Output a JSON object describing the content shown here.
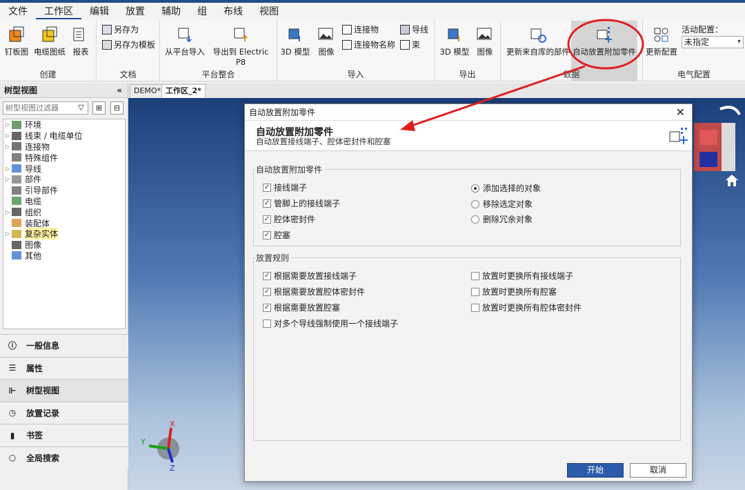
{
  "menu": [
    "文件",
    "工作区",
    "编辑",
    "放置",
    "辅助",
    "组",
    "布线",
    "视图"
  ],
  "menu_active": "工作区",
  "ribbon": {
    "create": {
      "label": "创建",
      "buttons": [
        "钉板图",
        "电缆图纸",
        "报表"
      ]
    },
    "doc": {
      "label": "文档",
      "buttons": [
        "另存为",
        "另存为模板"
      ]
    },
    "platform": {
      "label": "平台整合",
      "buttons": [
        "从平台导入",
        "导出到 Electric P8"
      ]
    },
    "import": {
      "label": "导入",
      "buttons": [
        "3D 模型",
        "图像",
        "连接物",
        "连接物名称",
        "导线",
        "束"
      ]
    },
    "export": {
      "label": "导出",
      "buttons": [
        "3D 模型",
        "图像"
      ]
    },
    "data": {
      "label": "数据",
      "buttons": [
        "更新来自库的部件",
        "自动放置附加零件"
      ]
    },
    "elec": {
      "label": "电气配置",
      "update": "更新配置",
      "active_label": "活动配置：",
      "active_value": "未指定"
    }
  },
  "doc_tabs": [
    "DEMO*",
    "工作区_2*"
  ],
  "left": {
    "title": "树型视图",
    "collapse": "«",
    "filter_placeholder": "树型视图过滤器",
    "tree": [
      {
        "label": "环境",
        "exp": true
      },
      {
        "label": "线束 / 电缆单位",
        "exp": true
      },
      {
        "label": "连接物",
        "exp": true
      },
      {
        "label": "特殊组件",
        "exp": false
      },
      {
        "label": "导线",
        "exp": true
      },
      {
        "label": "部件",
        "exp": true
      },
      {
        "label": "引导部件",
        "exp": false
      },
      {
        "label": "电缆",
        "exp": false
      },
      {
        "label": "组织",
        "exp": true
      },
      {
        "label": "装配体",
        "exp": false
      },
      {
        "label": "复杂实体",
        "exp": true,
        "hi": true
      },
      {
        "label": "图像",
        "exp": false
      },
      {
        "label": "其他",
        "exp": false
      }
    ],
    "nav": [
      "一般信息",
      "属性",
      "树型视图",
      "放置记录",
      "书签",
      "全局搜索"
    ]
  },
  "dialog": {
    "title": "自动放置附加零件",
    "heading": "自动放置附加零件",
    "subheading": "自动放置接线端子、腔体密封件和腔塞",
    "sec1": "自动放置附加零件",
    "checks1": [
      "接线端子",
      "管脚上的接线端子",
      "腔体密封件",
      "腔塞"
    ],
    "radios": [
      "添加选择的对象",
      "移除选定对象",
      "删除冗余对象"
    ],
    "sec2": "放置规则",
    "rules_left": [
      "根据需要放置接线端子",
      "根据需要放置腔体密封件",
      "根据需要放置腔塞",
      "对多个导线强制使用一个接线端子"
    ],
    "rules_right": [
      "放置时更换所有接线端子",
      "放置时更换所有腔塞",
      "放置时更换所有腔体密封件"
    ],
    "ok": "开始",
    "cancel": "取消",
    "close": "✕"
  },
  "axes": {
    "x": "X",
    "y": "Y",
    "z": "Z"
  },
  "colors": {
    "accent": "#2c5bab",
    "annotation": "#e02020",
    "viewport_top": "#1c3f7a"
  }
}
